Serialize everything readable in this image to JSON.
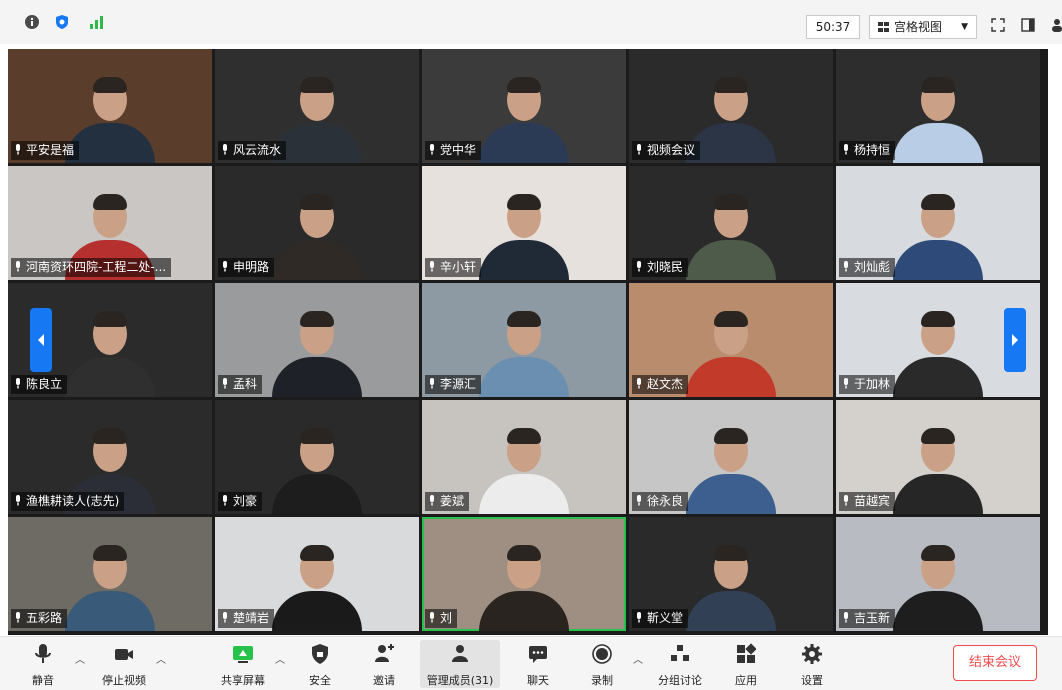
{
  "topbar": {
    "info_icon": "info-icon",
    "shield_icon": "shield-icon",
    "signal_icon": "signal-icon",
    "timer": "50:37",
    "view_label": "宫格视图",
    "view_caret": "▼",
    "fullscreen_icon": "fullscreen-icon",
    "sidebar_icon": "sidebar-toggle-icon"
  },
  "participants": [
    {
      "name": "平安是福",
      "bg": "#5a3d2b",
      "shirt": "#23303f"
    },
    {
      "name": "风云流水",
      "bg": "#2f2f2f",
      "shirt": "#2a3138"
    },
    {
      "name": "党中华",
      "bg": "#3b3b3b",
      "shirt": "#2b3a55"
    },
    {
      "name": "视频会议",
      "bg": "#2b2b2b",
      "shirt": "#2c3545"
    },
    {
      "name": "杨持恒",
      "bg": "#2d2d2d",
      "shirt": "#b9cde6"
    },
    {
      "name": "河南资环四院-工程二处-...",
      "bg": "#c9c6c3",
      "shirt": "#b5302e"
    },
    {
      "name": "申明路",
      "bg": "#2a2a2a",
      "shirt": "#2f2a26"
    },
    {
      "name": "辛小轩",
      "bg": "#e7e1dd",
      "shirt": "#1f2a36"
    },
    {
      "name": "刘晓民",
      "bg": "#2a2a2a",
      "shirt": "#4e5b4a"
    },
    {
      "name": "刘灿彪",
      "bg": "#d7dadf",
      "shirt": "#2d4a78"
    },
    {
      "name": "陈良立",
      "bg": "#2b2b2b",
      "shirt": "#2f2f2f"
    },
    {
      "name": "孟科",
      "bg": "#9a9b9c",
      "shirt": "#1e2228"
    },
    {
      "name": "李源汇",
      "bg": "#8e9aa3",
      "shirt": "#6b8fb0"
    },
    {
      "name": "赵文杰",
      "bg": "#b98c6e",
      "shirt": "#c23a2a"
    },
    {
      "name": "于加林",
      "bg": "#d8dbe0",
      "shirt": "#2a2a2a"
    },
    {
      "name": "渔樵耕读人(志先)",
      "bg": "#2b2b2b",
      "shirt": "#2b2e36"
    },
    {
      "name": "刘豪",
      "bg": "#2a2a2a",
      "shirt": "#1d1d1d"
    },
    {
      "name": "姜斌",
      "bg": "#c7c3bf",
      "shirt": "#ececec"
    },
    {
      "name": "徐永良",
      "bg": "#c6c6c6",
      "shirt": "#3c5f8f"
    },
    {
      "name": "苗越宾",
      "bg": "#d4d1cd",
      "shirt": "#262626"
    },
    {
      "name": "五彩路",
      "bg": "#6e6a64",
      "shirt": "#3a5a7a"
    },
    {
      "name": "楚靖岩",
      "bg": "#d9dadb",
      "shirt": "#1a1a1a"
    },
    {
      "name": "刘",
      "bg": "#9e8f82",
      "shirt": "#2a2420"
    },
    {
      "name": "靳义堂",
      "bg": "#2a2a2a",
      "shirt": "#324055"
    },
    {
      "name": "吉玉新",
      "bg": "#b8bcc2",
      "shirt": "#1e1e1e"
    }
  ],
  "toolbar": {
    "mute": "静音",
    "stop_video": "停止视频",
    "share_screen": "共享屏幕",
    "security": "安全",
    "invite": "邀请",
    "members": "管理成员(31)",
    "chat": "聊天",
    "record": "录制",
    "breakout": "分组讨论",
    "apps": "应用",
    "settings": "设置",
    "end_meeting": "结束会议",
    "caret": "︿"
  },
  "colors": {
    "accent_blue": "#1678f2",
    "active_speaker": "#27c24c",
    "end_red": "#f14b4b"
  }
}
